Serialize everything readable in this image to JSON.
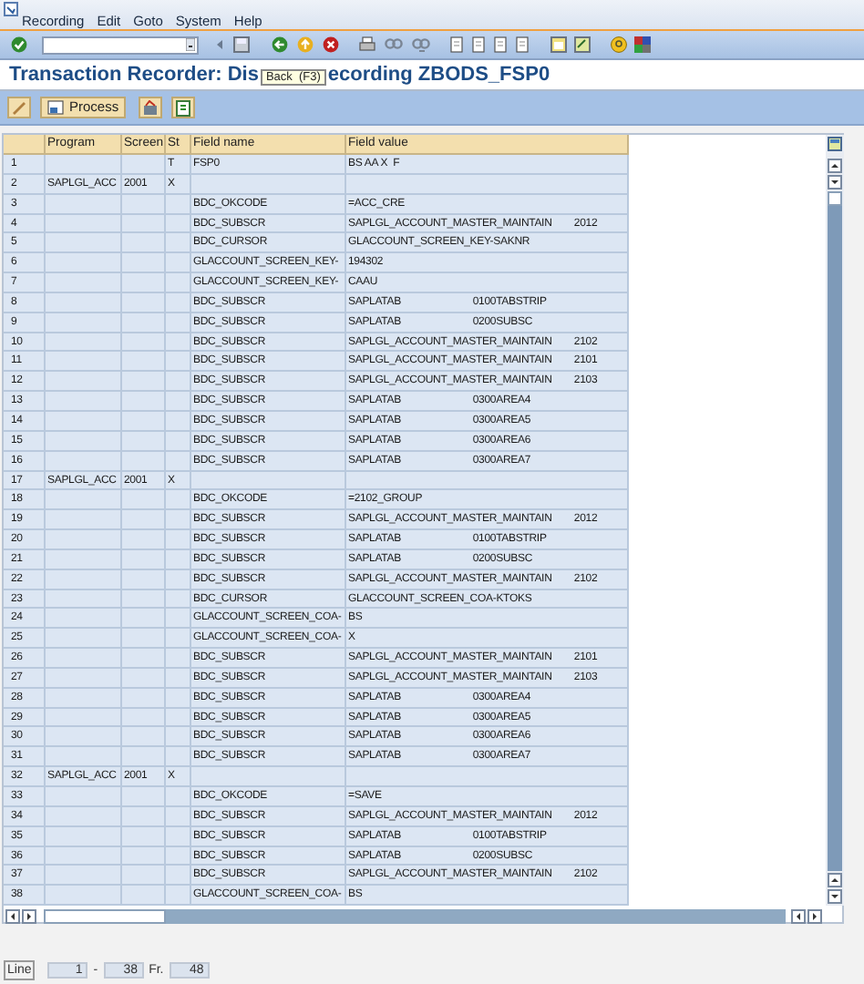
{
  "menu": [
    {
      "label": "Recording"
    },
    {
      "label": "Edit"
    },
    {
      "label": "Goto"
    },
    {
      "label": "System"
    },
    {
      "label": "Help"
    }
  ],
  "tooltip": "Back  (F3)",
  "title_parts": [
    "Transaction Recorder: Dis",
    "ecording ZBODS_FSP0"
  ],
  "app_toolbar": {
    "process_button": "Process"
  },
  "table": {
    "columns": [
      "Program",
      "Screen",
      "St",
      "Field name",
      "Field value"
    ],
    "rows": [
      {
        "no": "1",
        "st": "T",
        "field": "FSP0",
        "value": "BS AA X  F"
      },
      {
        "no": "2",
        "program": "SAPLGL_ACC",
        "screen": "2001",
        "st": "X"
      },
      {
        "no": "3",
        "field": "BDC_OKCODE",
        "value": "=ACC_CRE"
      },
      {
        "no": "4",
        "field": "BDC_SUBSCR",
        "value": "SAPLGL_ACCOUNT_MASTER_MAINTAIN        2012"
      },
      {
        "no": "5",
        "field": "BDC_CURSOR",
        "value": "GLACCOUNT_SCREEN_KEY-SAKNR"
      },
      {
        "no": "6",
        "field": "GLACCOUNT_SCREEN_KEY-",
        "value": "194302"
      },
      {
        "no": "7",
        "field": "GLACCOUNT_SCREEN_KEY-",
        "value": "CAAU"
      },
      {
        "no": "8",
        "field": "BDC_SUBSCR",
        "value": "SAPLATAB                          0100TABSTRIP"
      },
      {
        "no": "9",
        "field": "BDC_SUBSCR",
        "value": "SAPLATAB                          0200SUBSC"
      },
      {
        "no": "10",
        "field": "BDC_SUBSCR",
        "value": "SAPLGL_ACCOUNT_MASTER_MAINTAIN        2102"
      },
      {
        "no": "11",
        "field": "BDC_SUBSCR",
        "value": "SAPLGL_ACCOUNT_MASTER_MAINTAIN        2101"
      },
      {
        "no": "12",
        "field": "BDC_SUBSCR",
        "value": "SAPLGL_ACCOUNT_MASTER_MAINTAIN        2103"
      },
      {
        "no": "13",
        "field": "BDC_SUBSCR",
        "value": "SAPLATAB                          0300AREA4"
      },
      {
        "no": "14",
        "field": "BDC_SUBSCR",
        "value": "SAPLATAB                          0300AREA5"
      },
      {
        "no": "15",
        "field": "BDC_SUBSCR",
        "value": "SAPLATAB                          0300AREA6"
      },
      {
        "no": "16",
        "field": "BDC_SUBSCR",
        "value": "SAPLATAB                          0300AREA7"
      },
      {
        "no": "17",
        "program": "SAPLGL_ACC",
        "screen": "2001",
        "st": "X"
      },
      {
        "no": "18",
        "field": "BDC_OKCODE",
        "value": "=2102_GROUP"
      },
      {
        "no": "19",
        "field": "BDC_SUBSCR",
        "value": "SAPLGL_ACCOUNT_MASTER_MAINTAIN        2012"
      },
      {
        "no": "20",
        "field": "BDC_SUBSCR",
        "value": "SAPLATAB                          0100TABSTRIP"
      },
      {
        "no": "21",
        "field": "BDC_SUBSCR",
        "value": "SAPLATAB                          0200SUBSC"
      },
      {
        "no": "22",
        "field": "BDC_SUBSCR",
        "value": "SAPLGL_ACCOUNT_MASTER_MAINTAIN        2102"
      },
      {
        "no": "23",
        "field": "BDC_CURSOR",
        "value": "GLACCOUNT_SCREEN_COA-KTOKS"
      },
      {
        "no": "24",
        "field": "GLACCOUNT_SCREEN_COA-",
        "value": "BS"
      },
      {
        "no": "25",
        "field": "GLACCOUNT_SCREEN_COA-",
        "value": "X"
      },
      {
        "no": "26",
        "field": "BDC_SUBSCR",
        "value": "SAPLGL_ACCOUNT_MASTER_MAINTAIN        2101"
      },
      {
        "no": "27",
        "field": "BDC_SUBSCR",
        "value": "SAPLGL_ACCOUNT_MASTER_MAINTAIN        2103"
      },
      {
        "no": "28",
        "field": "BDC_SUBSCR",
        "value": "SAPLATAB                          0300AREA4"
      },
      {
        "no": "29",
        "field": "BDC_SUBSCR",
        "value": "SAPLATAB                          0300AREA5"
      },
      {
        "no": "30",
        "field": "BDC_SUBSCR",
        "value": "SAPLATAB                          0300AREA6"
      },
      {
        "no": "31",
        "field": "BDC_SUBSCR",
        "value": "SAPLATAB                          0300AREA7"
      },
      {
        "no": "32",
        "program": "SAPLGL_ACC",
        "screen": "2001",
        "st": "X"
      },
      {
        "no": "33",
        "field": "BDC_OKCODE",
        "value": "=SAVE"
      },
      {
        "no": "34",
        "field": "BDC_SUBSCR",
        "value": "SAPLGL_ACCOUNT_MASTER_MAINTAIN        2012"
      },
      {
        "no": "35",
        "field": "BDC_SUBSCR",
        "value": "SAPLATAB                          0100TABSTRIP"
      },
      {
        "no": "36",
        "field": "BDC_SUBSCR",
        "value": "SAPLATAB                          0200SUBSC"
      },
      {
        "no": "37",
        "field": "BDC_SUBSCR",
        "value": "SAPLGL_ACCOUNT_MASTER_MAINTAIN        2102"
      },
      {
        "no": "38",
        "field": "GLACCOUNT_SCREEN_COA-",
        "value": "BS"
      }
    ]
  },
  "footer": {
    "line_label": "Line",
    "from": "1",
    "separator": "-",
    "to": "38",
    "total_label": "Fr.",
    "total": "48"
  }
}
